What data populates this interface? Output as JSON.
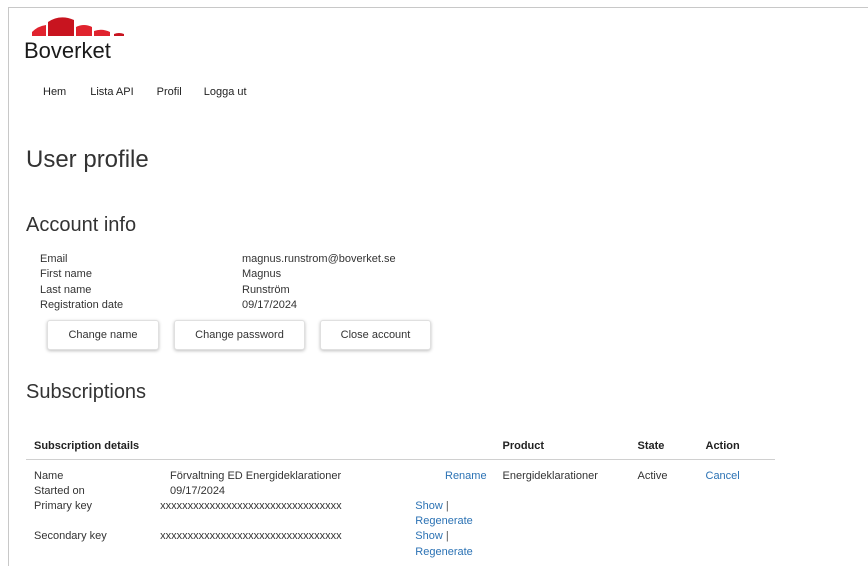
{
  "brand": {
    "name": "Boverket"
  },
  "nav": [
    "Hem",
    "Lista API",
    "Profil",
    "Logga ut"
  ],
  "page_title": "User profile",
  "account": {
    "heading": "Account info",
    "fields": [
      {
        "label": "Email",
        "value": "magnus.runstrom@boverket.se"
      },
      {
        "label": "First name",
        "value": "Magnus"
      },
      {
        "label": "Last name",
        "value": "Runström"
      },
      {
        "label": "Registration date",
        "value": "09/17/2024"
      }
    ],
    "buttons": {
      "change_name": "Change name",
      "change_password": "Change password",
      "close_account": "Close account"
    }
  },
  "subscriptions": {
    "heading": "Subscriptions",
    "columns": [
      "Subscription details",
      "Product",
      "State",
      "Action"
    ],
    "rows": [
      {
        "name_label": "Name",
        "name": "Förvaltning ED Energideklarationer",
        "rename": "Rename",
        "started_label": "Started on",
        "started": "09/17/2024",
        "primary_label": "Primary key",
        "primary": "xxxxxxxxxxxxxxxxxxxxxxxxxxxxxxxxx",
        "secondary_label": "Secondary key",
        "secondary": "xxxxxxxxxxxxxxxxxxxxxxxxxxxxxxxxx",
        "show": "Show",
        "separator": "|",
        "regenerate": "Regenerate",
        "product": "Energideklarationer",
        "state": "Active",
        "action": "Cancel"
      }
    ]
  },
  "colors": {
    "brand_red": "#e0232e",
    "link": "#2b72b4"
  }
}
